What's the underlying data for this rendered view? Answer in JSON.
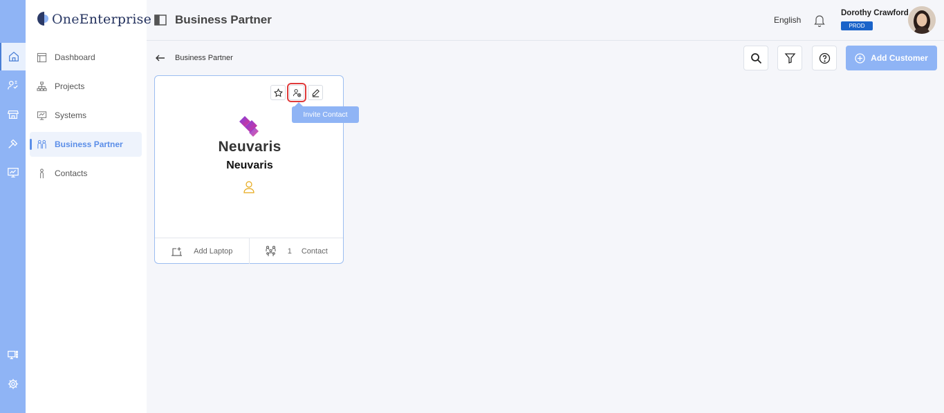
{
  "app": {
    "brand_prefix": "One",
    "brand_suffix": "Enterprise"
  },
  "rail": {
    "items": [
      {
        "icon": "home-icon"
      },
      {
        "icon": "users-icon"
      },
      {
        "icon": "store-icon"
      },
      {
        "icon": "tools-icon"
      },
      {
        "icon": "monitor-chart-icon"
      },
      {
        "icon": "device-grid-icon"
      },
      {
        "icon": "settings-icon"
      }
    ]
  },
  "sidebar": {
    "items": [
      {
        "label": "Dashboard",
        "icon": "dashboard-icon"
      },
      {
        "label": "Projects",
        "icon": "hierarchy-icon"
      },
      {
        "label": "Systems",
        "icon": "systems-icon"
      },
      {
        "label": "Business Partner",
        "icon": "partner-icon",
        "active": true
      },
      {
        "label": "Contacts",
        "icon": "person-icon"
      }
    ]
  },
  "header": {
    "title": "Business Partner",
    "language": "English",
    "user_name": "Dorothy Crawford",
    "environment": "PROD"
  },
  "toolbar": {
    "breadcrumb": "Business Partner",
    "add_label": "Add Customer"
  },
  "card": {
    "brand_logo_text": "Neuvaris",
    "company_name": "Neuvaris",
    "footer_add_label": "Add Laptop",
    "contact_count": "1",
    "contact_label": "Contact"
  },
  "tooltip": {
    "text": "Invite Contact"
  },
  "colors": {
    "accent": "#8fb4f5",
    "active_text": "#5b8ee8",
    "badge": "#1a63c9",
    "highlight": "#e03a3a",
    "contact_icon": "#e6a817"
  }
}
